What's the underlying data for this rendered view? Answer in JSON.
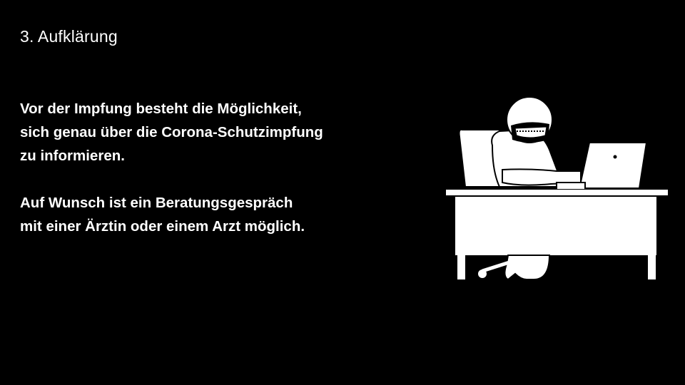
{
  "slide": {
    "title": "3. Aufklärung",
    "paragraph1": [
      "Vor der Impfung besteht die Möglichkeit,",
      "sich genau über die Corona-Schutzimpfung",
      "zu informieren."
    ],
    "paragraph2": [
      "Auf Wunsch ist ein Beratungsgespräch",
      "mit einer Ärztin oder einem Arzt möglich."
    ]
  },
  "illustration": {
    "icon": "person-at-desk-with-laptop-icon",
    "colors": {
      "background": "#000000",
      "foreground": "#ffffff"
    }
  }
}
